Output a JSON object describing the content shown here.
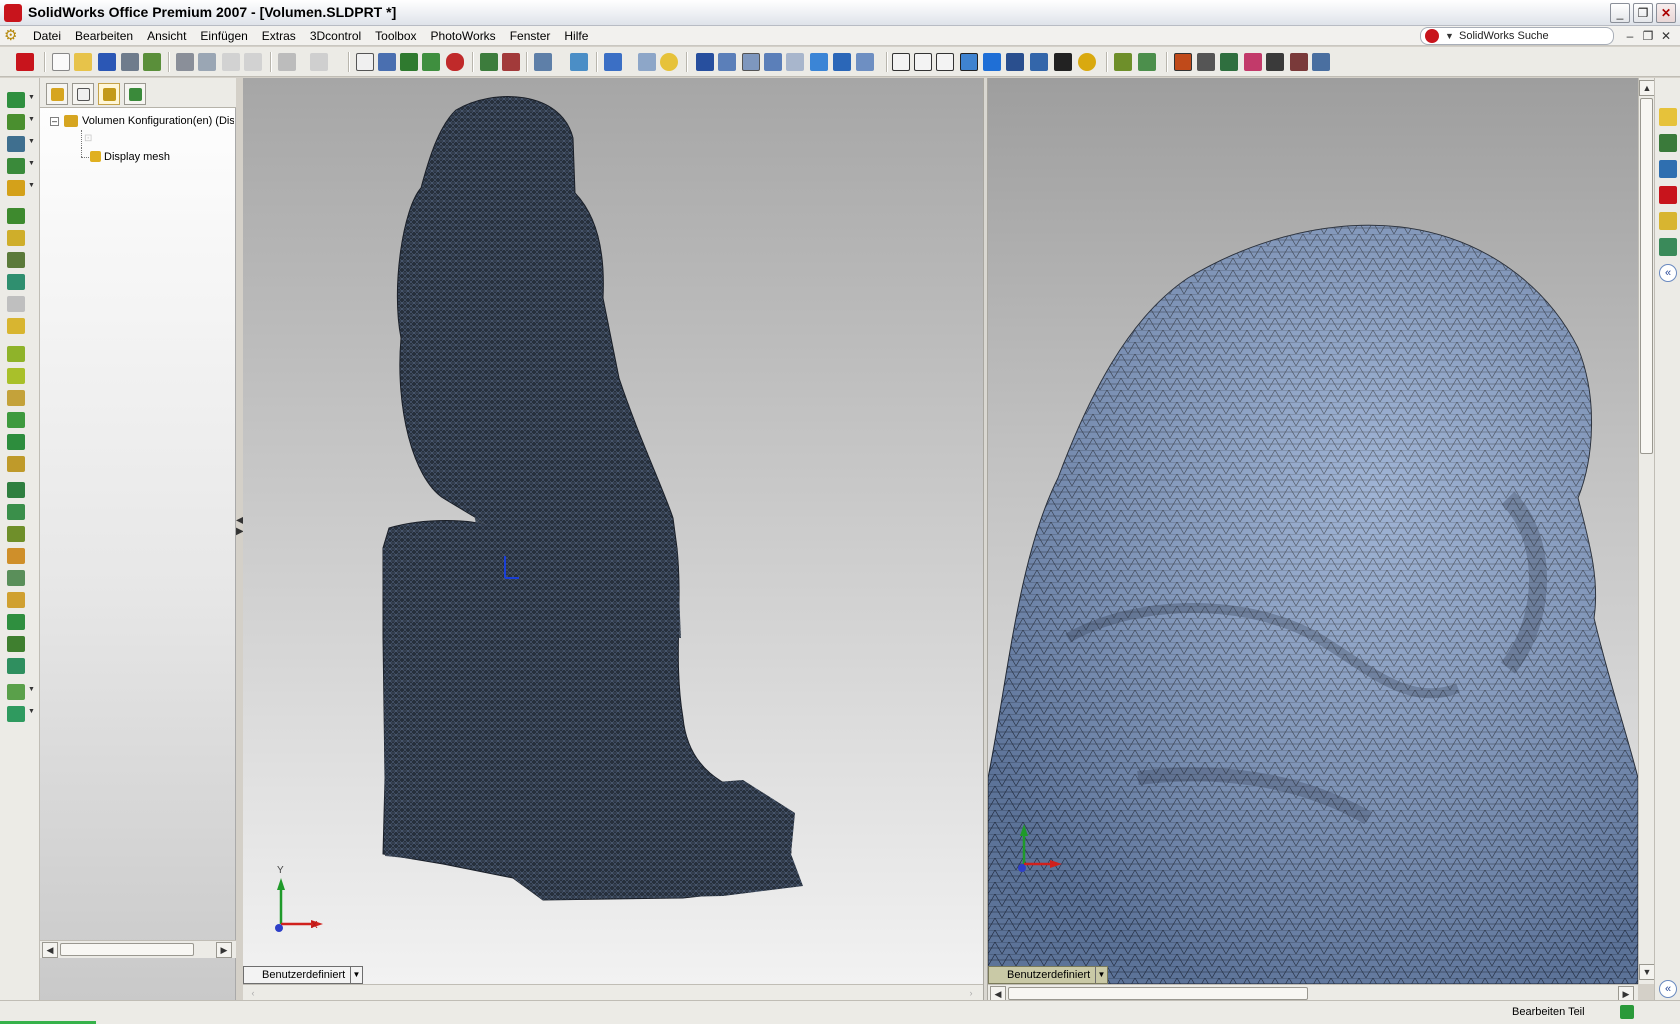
{
  "window": {
    "title": "SolidWorks Office Premium 2007 - [Volumen.SLDPRT *]",
    "minimize": "_",
    "restore": "❐",
    "close": "✕"
  },
  "menubar": {
    "items": [
      "Datei",
      "Bearbeiten",
      "Ansicht",
      "Einfügen",
      "Extras",
      "3Dcontrol",
      "Toolbox",
      "PhotoWorks",
      "Fenster",
      "Hilfe"
    ],
    "search_placeholder": "SolidWorks Suche",
    "doc_minimize": "–",
    "doc_restore": "❐",
    "doc_close": "✕"
  },
  "feature_manager": {
    "tabs": [
      "feature-manager-tab",
      "property-manager-tab",
      "configuration-manager-tab",
      "display-manager-tab"
    ],
    "active_tab": 2,
    "tree": {
      "root_label": "Volumen Konfiguration(en)  (Dis",
      "expander": "–",
      "child_label": "Display mesh"
    }
  },
  "viewports": {
    "left": {
      "view_orientation": "Benutzerdefiniert",
      "triad_x": "X",
      "triad_y": "Y"
    },
    "right": {
      "view_orientation": "Benutzerdefiniert"
    }
  },
  "statusbar": {
    "mode_text": "Bearbeiten Teil"
  },
  "colors": {
    "mesh_dark": "#2a3340",
    "mesh_blue": "#7f9ac6",
    "background_top": "#a6a6a6",
    "background_bottom": "#f2f2f2",
    "accent_red": "#c8141c"
  }
}
